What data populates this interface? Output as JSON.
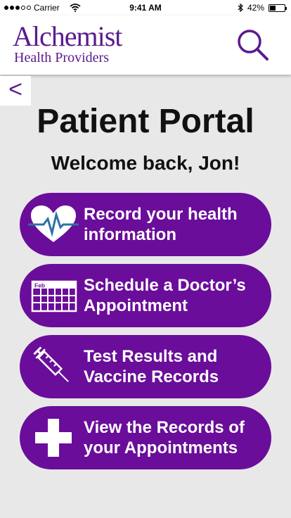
{
  "status_bar": {
    "carrier": "Carrier",
    "time": "9:41 AM",
    "battery": "42%",
    "battery_level": 0.42
  },
  "header": {
    "brand_title": "Alchemist",
    "brand_subtitle": "Health Providers",
    "search_icon": "search-icon"
  },
  "nav": {
    "back_label": "<"
  },
  "main": {
    "title": "Patient Portal",
    "welcome": "Welcome back, Jon!",
    "actions": [
      {
        "label": "Record your health information",
        "icon": "heart-pulse-icon"
      },
      {
        "label": "Schedule a Doctor’s Appointment",
        "icon": "calendar-icon",
        "calendar_month": "Feb"
      },
      {
        "label": "Test Results and Vaccine Records",
        "icon": "syringe-icon"
      },
      {
        "label": "View the Records of your Appointments",
        "icon": "plus-icon"
      }
    ]
  },
  "colors": {
    "brand": "#5c1a8e",
    "button": "#6a0d9a",
    "background": "#e8e8e8"
  }
}
